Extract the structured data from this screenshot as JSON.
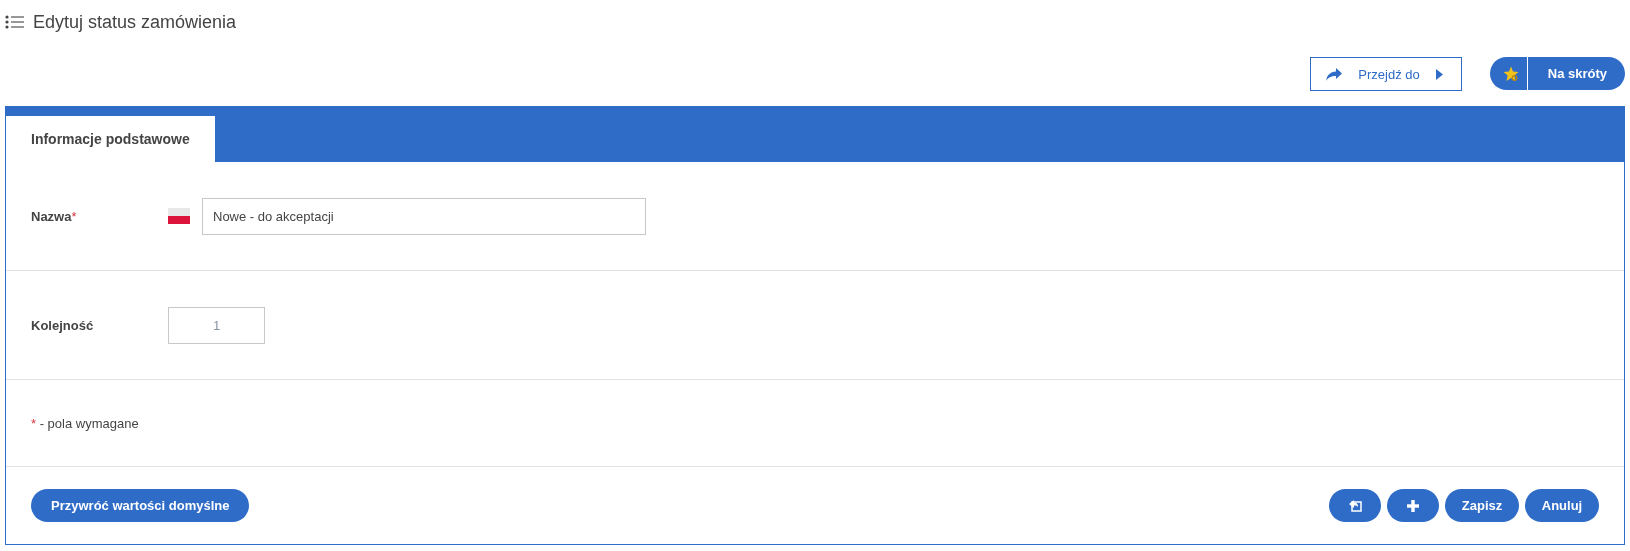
{
  "page": {
    "title": "Edytuj status zamówienia"
  },
  "toolbar": {
    "goto_button": "Przejdź do",
    "shortcuts_button": "Na skróty"
  },
  "tabs": [
    {
      "label": "Informacje podstawowe",
      "selected": true
    }
  ],
  "fields": [
    {
      "kind": "translated",
      "label": "Nazwa",
      "required_mark": "*",
      "value": "Nowe - do akceptacji"
    },
    {
      "kind": "number",
      "label": "Kolejność",
      "value": "1"
    }
  ],
  "legend": {
    "marker": "*",
    "text": "- pola wymagane"
  },
  "footer": {
    "reset_button": "Przywróć wartości domyślne",
    "save_button": "Zapisz",
    "cancel_button": "Anuluj"
  }
}
